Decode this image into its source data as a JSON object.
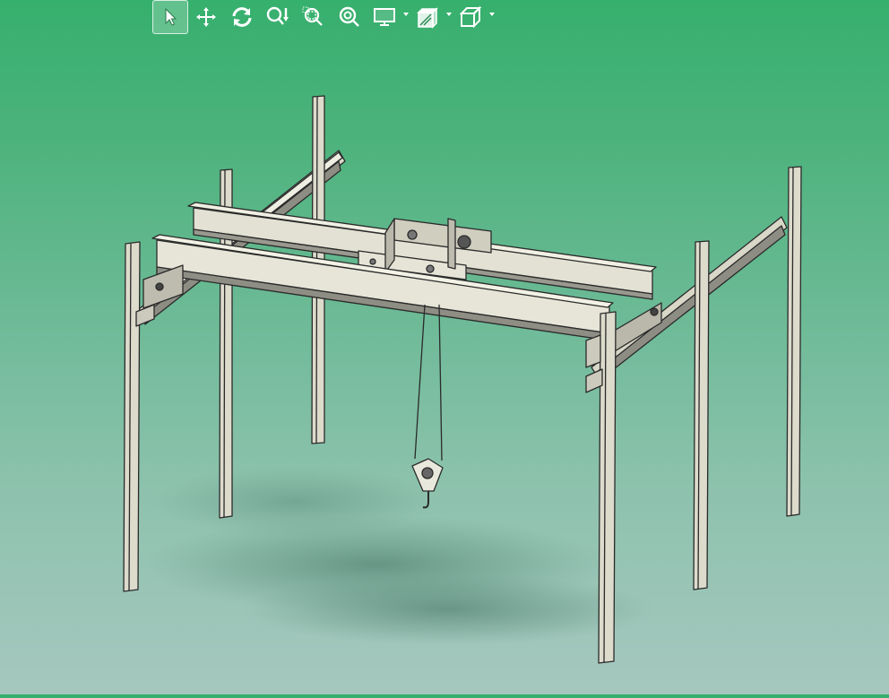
{
  "toolbar": {
    "tools": [
      {
        "id": "select",
        "icon": "select-arrow-icon",
        "active": true,
        "has_dropdown": false
      },
      {
        "id": "pan",
        "icon": "pan-move-icon",
        "active": false,
        "has_dropdown": false
      },
      {
        "id": "rotate",
        "icon": "rotate-icon",
        "active": false,
        "has_dropdown": false
      },
      {
        "id": "zoom",
        "icon": "zoom-dynamic-icon",
        "active": false,
        "has_dropdown": false
      },
      {
        "id": "zoom-window",
        "icon": "zoom-window-icon",
        "active": false,
        "has_dropdown": false
      },
      {
        "id": "zoom-fit",
        "icon": "zoom-fit-icon",
        "active": false,
        "has_dropdown": false
      },
      {
        "id": "display-mode",
        "icon": "monitor-icon",
        "active": false,
        "has_dropdown": true
      },
      {
        "id": "section",
        "icon": "section-icon",
        "active": false,
        "has_dropdown": true
      },
      {
        "id": "view-orientation",
        "icon": "cube-view-icon",
        "active": false,
        "has_dropdown": true
      }
    ]
  },
  "viewport": {
    "model": "overhead-crane-assembly",
    "background_top": "#36b06d",
    "background_bottom": "#a6c7bf",
    "part_fill": "#dcdbcc",
    "part_edge": "#2a2a2a"
  }
}
